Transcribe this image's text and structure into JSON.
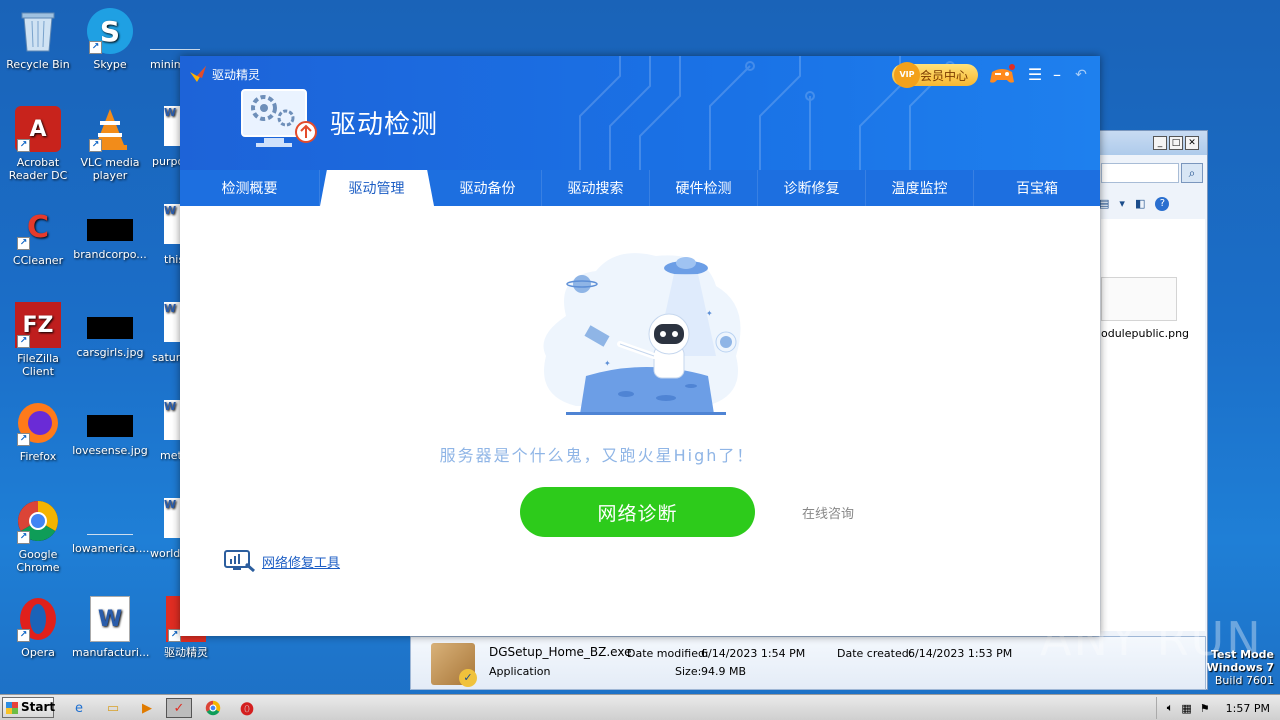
{
  "desktop": {
    "icons": [
      {
        "label": "Recycle Bin"
      },
      {
        "label": "Skype"
      },
      {
        "label": "minimum"
      },
      {
        "label": "Acrobat Reader DC"
      },
      {
        "label": "VLC media player"
      },
      {
        "label": "purpo"
      },
      {
        "label": "CCleaner"
      },
      {
        "label": "brandcorpo..."
      },
      {
        "label": "this"
      },
      {
        "label": "FileZilla Client"
      },
      {
        "label": "carsgirls.jpg"
      },
      {
        "label": "saturo"
      },
      {
        "label": "Firefox"
      },
      {
        "label": "lovesense.jpg"
      },
      {
        "label": "meto"
      },
      {
        "label": "Google Chrome"
      },
      {
        "label": "lowamerica...."
      },
      {
        "label": "worlds"
      },
      {
        "label": "Opera"
      },
      {
        "label": "manufacturi..."
      },
      {
        "label": "驱动精灵"
      }
    ]
  },
  "explorer": {
    "file_label": "odulepublic.png",
    "details": {
      "filename": "DGSetup_Home_BZ.exe",
      "type": "Application",
      "modified_label": "Date modified:",
      "modified": "6/14/2023 1:54 PM",
      "created_label": "Date created:",
      "created": "6/14/2023 1:53 PM",
      "size_label": "Size:",
      "size": "94.9 MB"
    }
  },
  "app": {
    "title": "驱动精灵",
    "heading": "驱动检测",
    "vip_label": "会员中心",
    "tabs": [
      {
        "label": "检测概要",
        "active": false
      },
      {
        "label": "驱动管理",
        "active": true
      },
      {
        "label": "驱动备份",
        "active": false
      },
      {
        "label": "驱动搜索",
        "active": false
      },
      {
        "label": "硬件检测",
        "active": false
      },
      {
        "label": "诊断修复",
        "active": false
      },
      {
        "label": "温度监控",
        "active": false
      },
      {
        "label": "百宝箱",
        "active": false
      }
    ],
    "message": "服务器是个什么鬼，又跑火星High了！",
    "diagnose_button": "网络诊断",
    "consult_link": "在线咨询",
    "repair_tool_link": "网络修复工具",
    "colors": {
      "header": "#1d6fe0",
      "button": "#2dcb1b",
      "link": "#1d5ec4"
    }
  },
  "watermark": "ANY RUN",
  "testmode": {
    "line1": "Test Mode",
    "line2": "Windows 7",
    "line3": "Build 7601"
  },
  "taskbar": {
    "start_label": "Start",
    "clock": "1:57 PM"
  }
}
